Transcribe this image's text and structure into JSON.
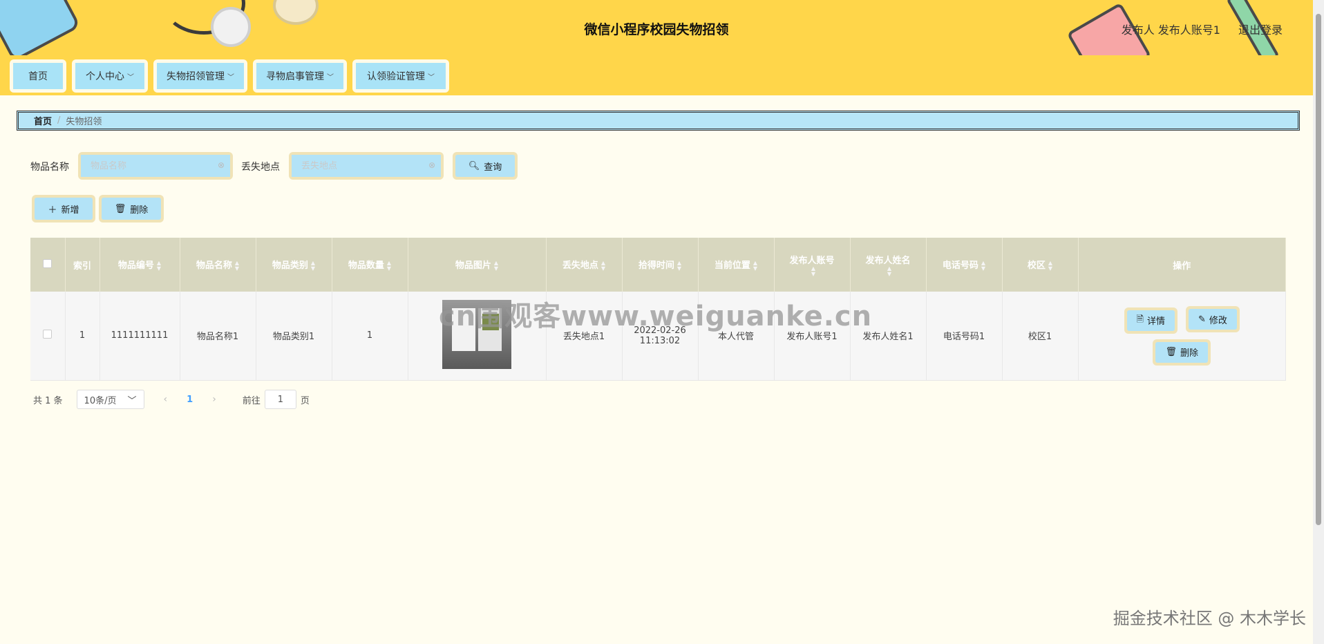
{
  "header": {
    "title": "微信小程序校园失物招领",
    "user": "发布人 发布人账号1",
    "logout": "退出登录"
  },
  "nav": [
    {
      "label": "首页",
      "dropdown": false
    },
    {
      "label": "个人中心",
      "dropdown": true
    },
    {
      "label": "失物招领管理",
      "dropdown": true
    },
    {
      "label": "寻物启事管理",
      "dropdown": true
    },
    {
      "label": "认领验证管理",
      "dropdown": true
    }
  ],
  "breadcrumb": {
    "home": "首页",
    "current": "失物招领"
  },
  "search": {
    "name_label": "物品名称",
    "name_placeholder": "物品名称",
    "place_label": "丢失地点",
    "place_placeholder": "丢失地点",
    "query_label": "查询"
  },
  "actions": {
    "add": "新增",
    "delete": "删除"
  },
  "table": {
    "headers": [
      "索引",
      "物品编号",
      "物品名称",
      "物品类别",
      "物品数量",
      "物品图片",
      "丢失地点",
      "拾得时间",
      "当前位置",
      "发布人账号",
      "发布人姓名",
      "电话号码",
      "校区",
      "操作"
    ],
    "rows": [
      {
        "index": "1",
        "code": "1111111111",
        "name": "物品名称1",
        "category": "物品类别1",
        "quantity": "1",
        "lost_place": "丢失地点1",
        "found_date": "2022-02-26",
        "found_time": "11:13:02",
        "location": "本人代管",
        "account": "发布人账号1",
        "publisher": "发布人姓名1",
        "phone": "电话号码1",
        "campus": "校区1"
      }
    ],
    "ops": {
      "detail": "详情",
      "edit": "修改",
      "delete": "删除"
    }
  },
  "pagination": {
    "total": "共 1 条",
    "page_size": "10条/页",
    "current": "1",
    "goto_prefix": "前往",
    "goto_value": "1",
    "goto_suffix": "页"
  },
  "watermark": "cn围观客www.weiguanke.cn",
  "footer_mark": "掘金技术社区 @ 木木学长",
  "colors": {
    "header_bg": "#ffd64a",
    "button_bg": "#b3e3f7",
    "button_border": "#f0e3b6",
    "page_bg": "#fffdf0"
  }
}
